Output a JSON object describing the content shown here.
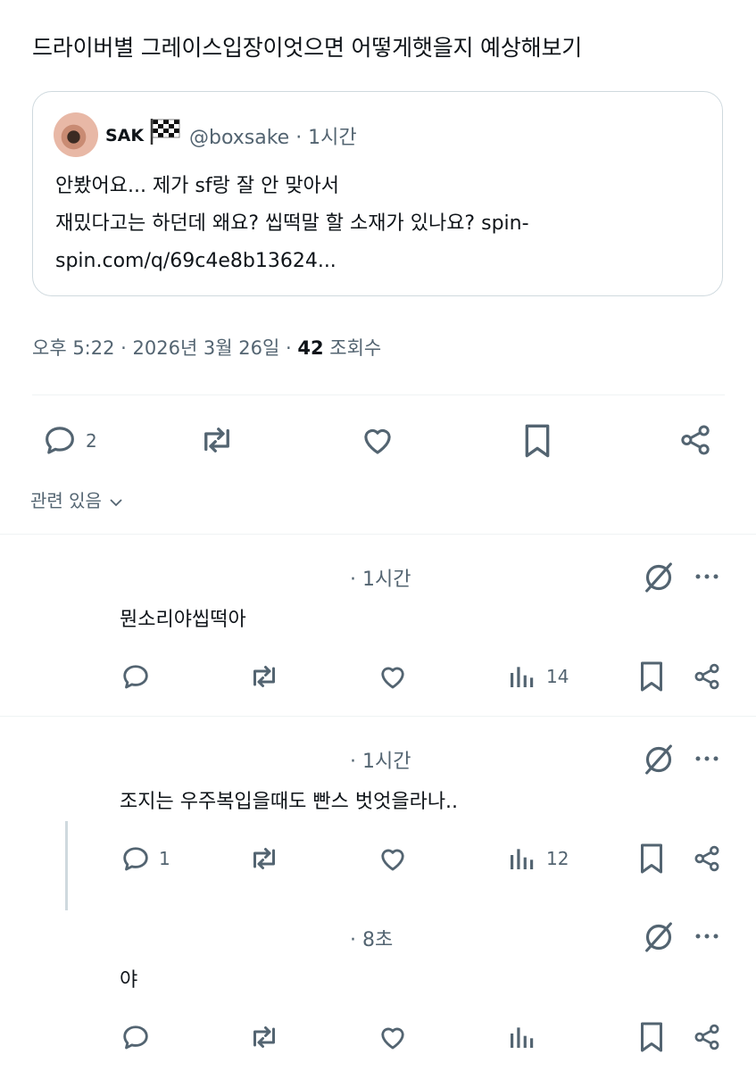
{
  "post": {
    "text": "드라이버별 그레이스입장이엇으면 어떻게햇을지 예상해보기",
    "quote": {
      "name": "SAK",
      "handle": "@boxsake · 1시간",
      "line1": "안봤어요... 제가 sf랑 잘 안 맞아서",
      "line2": "재밌다고는 하던데 왜요? 씹떡말 할 소재가 있나요? spin-",
      "line3": "spin.com/q/69c4e8b13624..."
    },
    "meta_time": "오후 5:22 · 2026년 3월 26일 · ",
    "meta_views": "42",
    "meta_views_label": " 조회수",
    "reply_count": "2"
  },
  "related_label": "관련 있음",
  "replies": [
    {
      "time": "· 1시간",
      "text": "뭔소리야씹떡아",
      "reply_count": "",
      "views": "14"
    },
    {
      "time": "· 1시간",
      "text": "조지는 우주복입을때도 빤스 벗엇을라나..",
      "reply_count": "1",
      "views": "12"
    },
    {
      "time": "· 8초",
      "text": "야",
      "reply_count": "",
      "views": ""
    }
  ],
  "colors": {
    "text": "#0f1419",
    "secondary": "#536471",
    "border": "#cfd9de",
    "divider": "#eff3f4"
  }
}
